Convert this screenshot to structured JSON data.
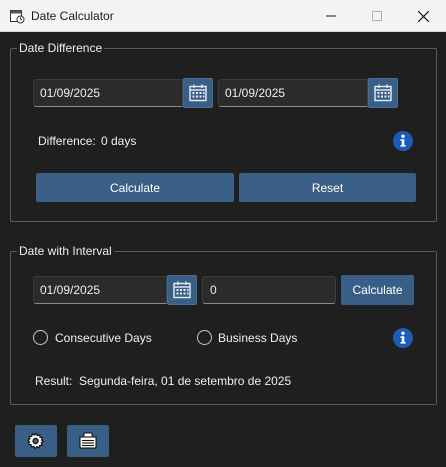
{
  "window": {
    "title": "Date Calculator",
    "minimize_icon": "minimize-icon",
    "maximize_icon": "maximize-icon",
    "close_icon": "close-icon"
  },
  "difference_group": {
    "title": "Date Difference",
    "start_date": "01/09/2025",
    "end_date": "01/09/2025",
    "difference_label": "Difference:",
    "difference_value": "0 days",
    "calculate_label": "Calculate",
    "reset_label": "Reset"
  },
  "interval_group": {
    "title": "Date with Interval",
    "date": "01/09/2025",
    "interval_value": "0",
    "calculate_label": "Calculate",
    "option_consecutive": "Consecutive Days",
    "option_business": "Business Days",
    "result_label": "Result:",
    "result_value": "Segunda-feira, 01 de setembro de 2025"
  },
  "toolbar": {
    "settings_icon": "gear-icon",
    "language_icon": "language-icon"
  },
  "colors": {
    "accent": "#3a5f86",
    "info": "#1e5bb8",
    "background": "#1f1f1f"
  }
}
